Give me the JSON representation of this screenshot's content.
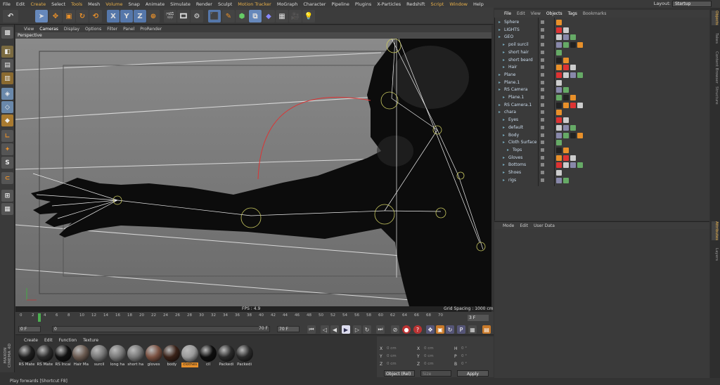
{
  "menubar": {
    "items": [
      "File",
      "Edit",
      "Create",
      "Select",
      "Tools",
      "Mesh",
      "Volume",
      "Snap",
      "Animate",
      "Simulate",
      "Render",
      "Sculpt",
      "Motion Tracker",
      "MoGraph",
      "Character",
      "Pipeline",
      "Plugins",
      "X-Particles",
      "Redshift",
      "Script",
      "Window",
      "Help"
    ],
    "layout_label": "Layout:",
    "layout_value": "Startup"
  },
  "toolbar": {
    "axis_x": "X",
    "axis_y": "Y",
    "axis_z": "Z"
  },
  "viewport": {
    "menu": [
      "View",
      "Cameras",
      "Display",
      "Options",
      "Filter",
      "Panel",
      "ProRender"
    ],
    "title": "Perspective",
    "fps": "FPS : 4.9",
    "grid_spacing": "Grid Spacing : 1000 cm"
  },
  "timeline": {
    "ticks": [
      "0",
      "2",
      "4",
      "6",
      "8",
      "10",
      "12",
      "14",
      "16",
      "18",
      "20",
      "22",
      "24",
      "26",
      "28",
      "30",
      "32",
      "34",
      "36",
      "38",
      "40",
      "42",
      "44",
      "46",
      "48",
      "50",
      "52",
      "54",
      "56",
      "58",
      "60",
      "62",
      "64",
      "66",
      "68",
      "70"
    ],
    "current_frame": "3 F",
    "start_field": "0 F",
    "end_field": "70 F",
    "max_field": "70 F",
    "mid_field": "0"
  },
  "materials": {
    "menu": [
      "Create",
      "Edit",
      "Function",
      "Texture"
    ],
    "items": [
      {
        "label": "RS Mate",
        "color": "#1e1e1e"
      },
      {
        "label": "RS Mate",
        "color": "#2a2a2a"
      },
      {
        "label": "RS Incai",
        "color": "#111111"
      },
      {
        "label": "Hair Ma",
        "color": "#6a5a50"
      },
      {
        "label": "surcil",
        "color": "#777777"
      },
      {
        "label": "long ha",
        "color": "#777777"
      },
      {
        "label": "short ha",
        "color": "#777777"
      },
      {
        "label": "gloves",
        "color": "#7a5040"
      },
      {
        "label": "body",
        "color": "#3a2218"
      },
      {
        "label": "clothes",
        "color": "#9a9a9a"
      },
      {
        "label": "cil",
        "color": "#0e0e0e"
      },
      {
        "label": "Packedi",
        "color": "#2a2a2a"
      },
      {
        "label": "Packedi",
        "color": "#2a2a2a"
      }
    ],
    "selected_index": 9
  },
  "coordinates": {
    "rows": [
      {
        "a": "X",
        "av": "0 cm",
        "b": "X",
        "bv": "0 cm",
        "c": "H",
        "cv": "0 °"
      },
      {
        "a": "Y",
        "av": "0 cm",
        "b": "Y",
        "bv": "0 cm",
        "c": "P",
        "cv": "0 °"
      },
      {
        "a": "Z",
        "av": "0 cm",
        "b": "Z",
        "bv": "0 cm",
        "c": "B",
        "cv": "0 °"
      }
    ],
    "mode": "Object (Rel)",
    "size_mode": "Size",
    "apply": "Apply"
  },
  "objects": {
    "menu": [
      "File",
      "Edit",
      "View",
      "Objects",
      "Tags",
      "Bookmarks"
    ],
    "rows": [
      {
        "name": "Sphere",
        "indent": 0
      },
      {
        "name": "LIGHTS",
        "indent": 0
      },
      {
        "name": "GEO",
        "indent": 0
      },
      {
        "name": "poil surcil",
        "indent": 1
      },
      {
        "name": "short hair",
        "indent": 1
      },
      {
        "name": "short beard",
        "indent": 1
      },
      {
        "name": "Hair",
        "indent": 1
      },
      {
        "name": "Plane",
        "indent": 0
      },
      {
        "name": "Plane.1",
        "indent": 0
      },
      {
        "name": "RS Camera",
        "indent": 0
      },
      {
        "name": "Plane.1",
        "indent": 1
      },
      {
        "name": "RS Camera.1",
        "indent": 0
      },
      {
        "name": "chara",
        "indent": 0
      },
      {
        "name": "Eyes",
        "indent": 1
      },
      {
        "name": "default",
        "indent": 1
      },
      {
        "name": "Body",
        "indent": 1
      },
      {
        "name": "Cloth Surface",
        "indent": 1
      },
      {
        "name": "Tops",
        "indent": 2
      },
      {
        "name": "Gloves",
        "indent": 1
      },
      {
        "name": "Bottoms",
        "indent": 1
      },
      {
        "name": "Shoes",
        "indent": 1
      },
      {
        "name": "rigs",
        "indent": 1
      }
    ]
  },
  "attributes": {
    "menu": [
      "Mode",
      "Edit",
      "User Data"
    ]
  },
  "right_tabs": [
    "Objects",
    "Takes",
    "Content Browser",
    "Structure",
    "Attributes",
    "Layers"
  ],
  "status": "Play forwards [Shortcut F8]",
  "brand": {
    "line1": "MAXON",
    "line2": "CINEMA 4D"
  }
}
